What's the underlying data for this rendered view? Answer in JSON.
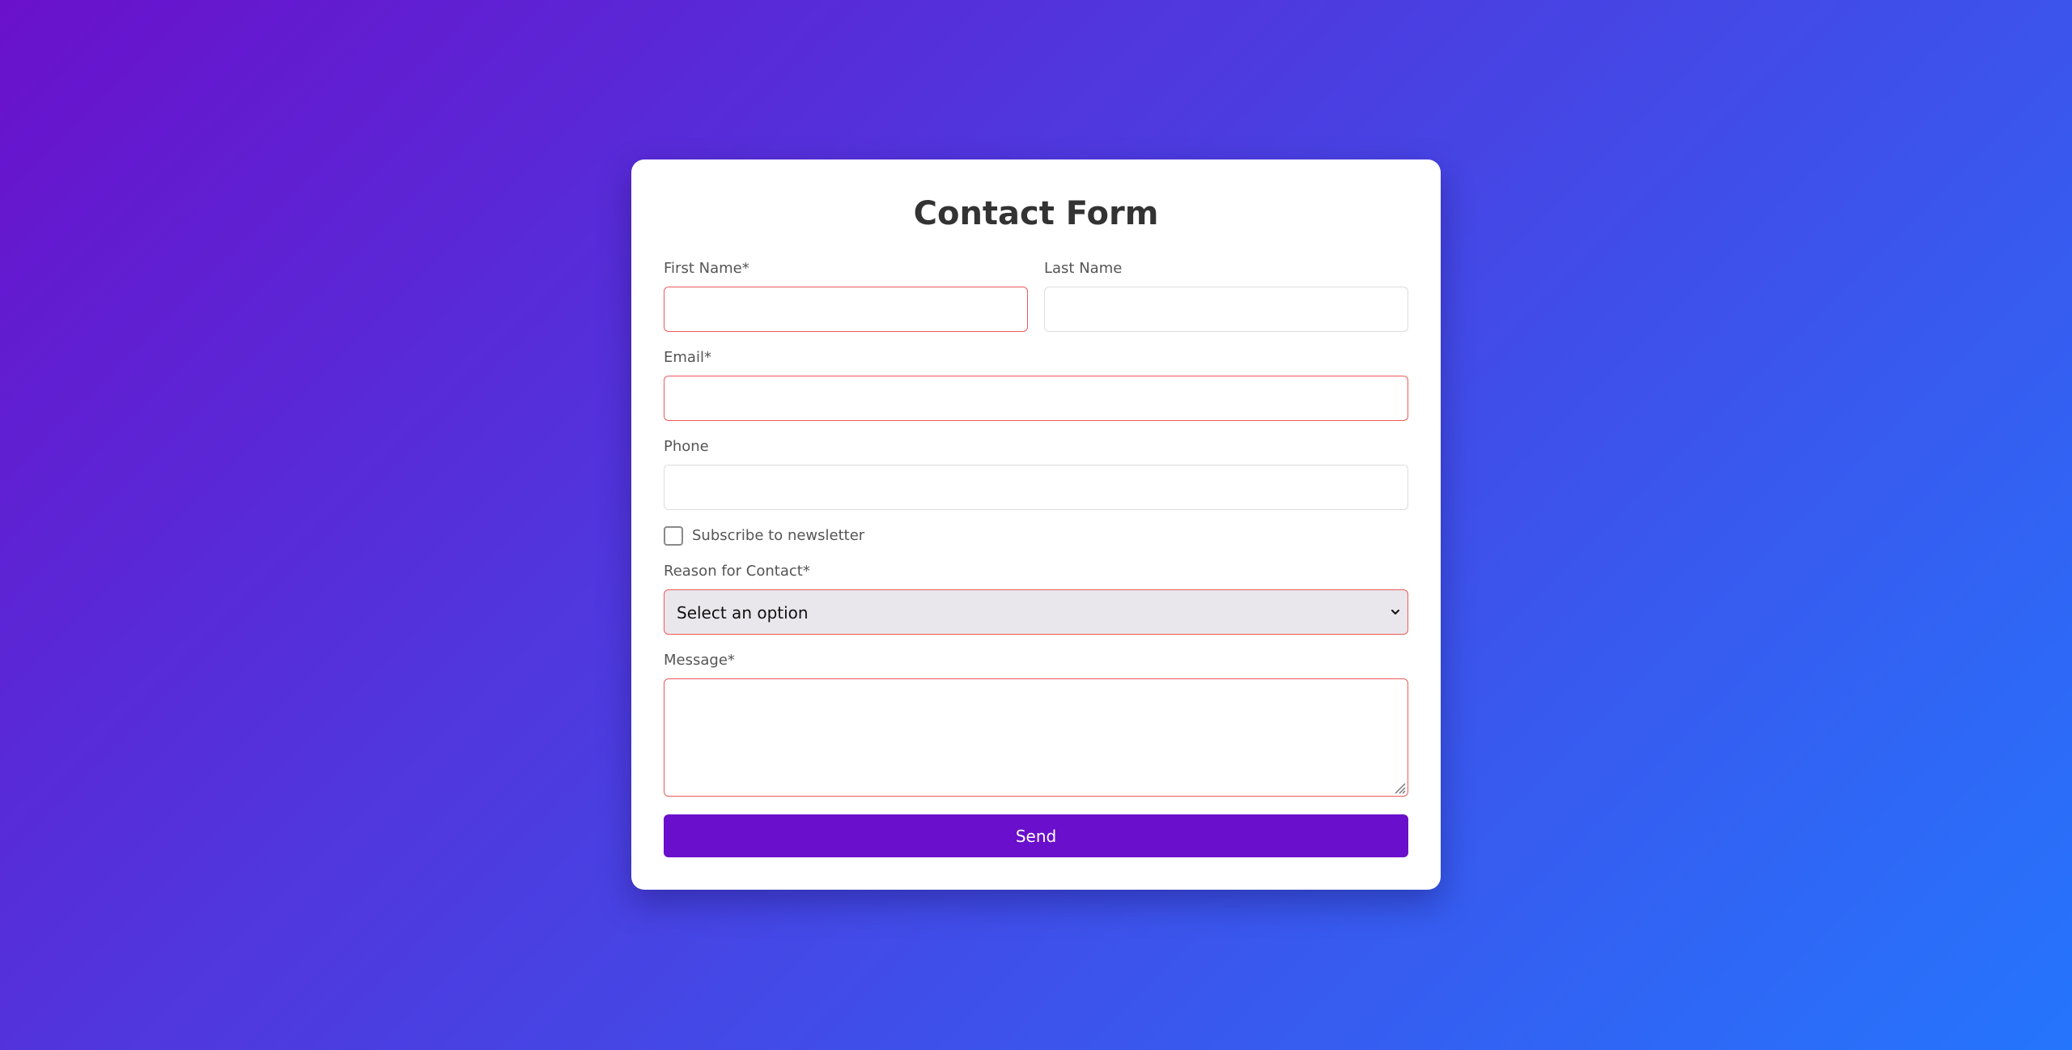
{
  "form": {
    "title": "Contact Form",
    "first_name": {
      "label": "First Name*",
      "value": "",
      "placeholder": ""
    },
    "last_name": {
      "label": "Last Name",
      "value": "",
      "placeholder": ""
    },
    "email": {
      "label": "Email*",
      "value": "",
      "placeholder": ""
    },
    "phone": {
      "label": "Phone",
      "value": "",
      "placeholder": ""
    },
    "newsletter": {
      "label": "Subscribe to newsletter",
      "checked": false
    },
    "reason": {
      "label": "Reason for Contact*",
      "selected": "Select an option"
    },
    "message": {
      "label": "Message*",
      "value": ""
    },
    "submit_label": "Send"
  },
  "colors": {
    "gradient_start": "#6a11cb",
    "gradient_end": "#2575fc",
    "invalid_border": "#ef5a5a",
    "button": "#6a0fcc"
  },
  "icons": {
    "select_arrow": "chevron-down-icon",
    "textarea_resize": "resize-grip-icon"
  }
}
